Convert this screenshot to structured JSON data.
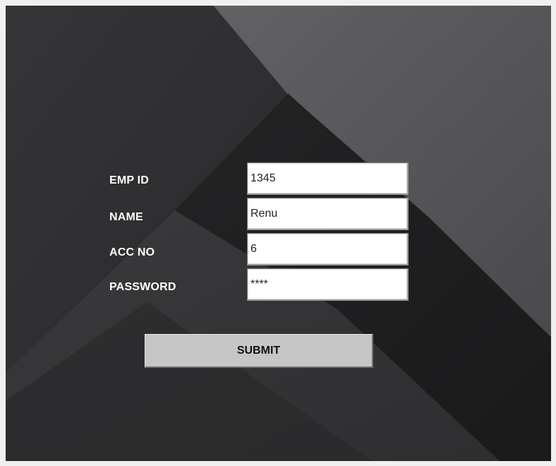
{
  "form": {
    "fields": [
      {
        "label": "EMP ID",
        "value": "1345"
      },
      {
        "label": "NAME",
        "value": "Renu"
      },
      {
        "label": "ACC NO",
        "value": "6"
      },
      {
        "label": "PASSWORD",
        "value": "****"
      }
    ],
    "submit_label": "SUBMIT"
  },
  "colors": {
    "background_dark": "#2c2c2e",
    "background_light": "#5c5c5e",
    "label_text": "#ffffff",
    "button_face": "#c6c6c6"
  }
}
